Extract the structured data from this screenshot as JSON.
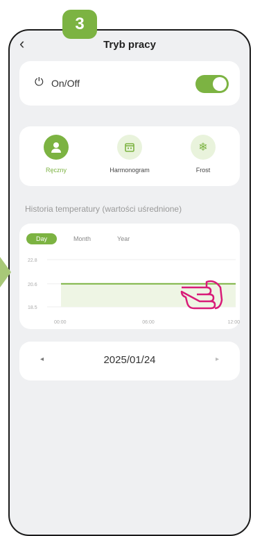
{
  "step": "3",
  "header": {
    "back": "‹",
    "title": "Tryb pracy"
  },
  "power": {
    "label": "On/Off",
    "on": true,
    "icon": "power-icon"
  },
  "modes": [
    {
      "label": "Ręczny",
      "icon": "person-icon",
      "active": true
    },
    {
      "label": "Harmonogram",
      "icon": "calendar-icon",
      "active": false
    },
    {
      "label": "Frost",
      "icon": "snowflake-icon",
      "active": false
    }
  ],
  "history": {
    "title": "Historia temperatury (wartości uśrednione)",
    "tabs": [
      "Day",
      "Month",
      "Year"
    ],
    "active_tab": "Day"
  },
  "chart_data": {
    "type": "line",
    "x": [
      "00:00",
      "06:00",
      "12:00"
    ],
    "y_ticks": [
      18.5,
      20.6,
      22.8
    ],
    "ylim": [
      18.5,
      22.8
    ],
    "series": [
      {
        "values": [
          20.6,
          20.6,
          20.6
        ]
      }
    ],
    "color": "#7cb342"
  },
  "date_nav": {
    "prev": "◂",
    "date": "2025/01/24",
    "next": "▸"
  },
  "colors": {
    "accent": "#7cb342",
    "hand": "#d81b78"
  }
}
